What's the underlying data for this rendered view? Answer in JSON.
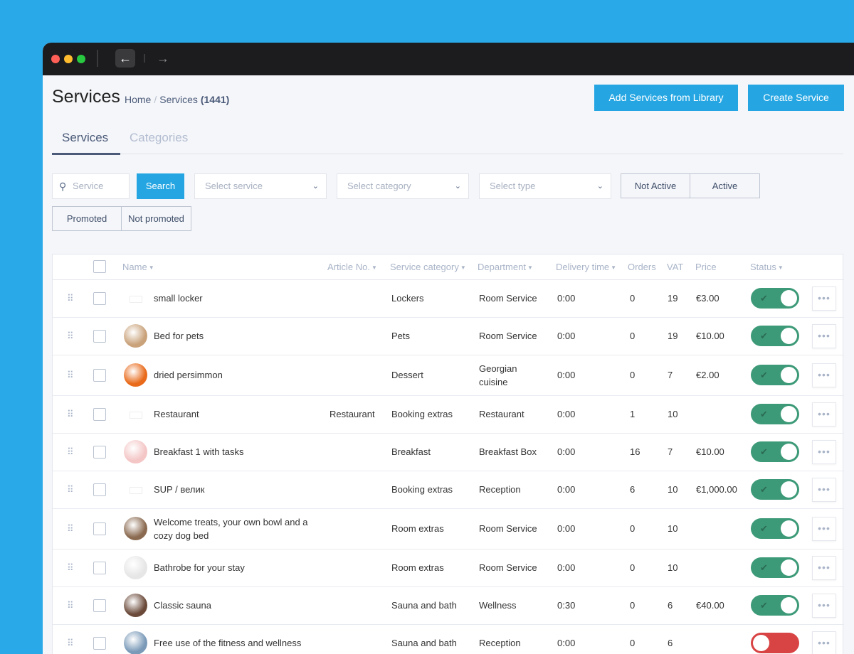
{
  "browser": {
    "back_icon": "←",
    "forward_icon": "→"
  },
  "header": {
    "title": "Services",
    "breadcrumb_home": "Home",
    "breadcrumb_sep": "/",
    "breadcrumb_current": "Services",
    "breadcrumb_count": "(1441)",
    "add_from_library": "Add Services from Library",
    "create_service": "Create Service"
  },
  "tabs": [
    {
      "label": "Services",
      "active": true
    },
    {
      "label": "Categories",
      "active": false
    }
  ],
  "filters": {
    "search_placeholder": "Service",
    "search_button": "Search",
    "select_service": "Select service",
    "select_category": "Select category",
    "select_type": "Select type",
    "not_active": "Not Active",
    "active": "Active",
    "promoted": "Promoted",
    "not_promoted": "Not promoted"
  },
  "columns": {
    "name": "Name",
    "article": "Article No.",
    "category": "Service category",
    "department": "Department",
    "delivery": "Delivery time",
    "orders": "Orders",
    "vat": "VAT",
    "price": "Price",
    "status": "Status"
  },
  "rows": [
    {
      "name": "small locker",
      "article": "",
      "category": "Lockers",
      "department": "Room Service",
      "delivery": "0:00",
      "orders": "0",
      "vat": "19",
      "price": "€3.00",
      "active": true,
      "avatar": "blank"
    },
    {
      "name": "Bed for pets",
      "article": "",
      "category": "Pets",
      "department": "Room Service",
      "delivery": "0:00",
      "orders": "0",
      "vat": "19",
      "price": "€10.00",
      "active": true,
      "avatar": "#c9a27a"
    },
    {
      "name": "dried persimmon",
      "article": "",
      "category": "Dessert",
      "department": "Georgian cuisine",
      "delivery": "0:00",
      "orders": "0",
      "vat": "7",
      "price": "€2.00",
      "active": true,
      "avatar": "#e86a1a"
    },
    {
      "name": "Restaurant",
      "article": "Restaurant",
      "category": "Booking extras",
      "department": "Restaurant",
      "delivery": "0:00",
      "orders": "1",
      "vat": "10",
      "price": "",
      "active": true,
      "avatar": "blank"
    },
    {
      "name": "Breakfast 1 with tasks",
      "article": "",
      "category": "Breakfast",
      "department": "Breakfast Box",
      "delivery": "0:00",
      "orders": "16",
      "vat": "7",
      "price": "€10.00",
      "active": true,
      "avatar": "#f4c6c6"
    },
    {
      "name": "SUP / велик",
      "article": "",
      "category": "Booking extras",
      "department": "Reception",
      "delivery": "0:00",
      "orders": "6",
      "vat": "10",
      "price": "€1,000.00",
      "active": true,
      "avatar": "blank"
    },
    {
      "name": "Welcome treats, your own bowl and a cozy dog bed",
      "article": "",
      "category": "Room extras",
      "department": "Room Service",
      "delivery": "0:00",
      "orders": "0",
      "vat": "10",
      "price": "",
      "active": true,
      "avatar": "#8a6a50"
    },
    {
      "name": "Bathrobe for your stay",
      "article": "",
      "category": "Room extras",
      "department": "Room Service",
      "delivery": "0:00",
      "orders": "0",
      "vat": "10",
      "price": "",
      "active": true,
      "avatar": "#e6e6e6"
    },
    {
      "name": "Classic sauna",
      "article": "",
      "category": "Sauna and bath",
      "department": "Wellness",
      "delivery": "0:30",
      "orders": "0",
      "vat": "6",
      "price": "€40.00",
      "active": true,
      "avatar": "#6b4a3a"
    },
    {
      "name": "Free use of the fitness and wellness",
      "article": "",
      "category": "Sauna and bath",
      "department": "Reception",
      "delivery": "0:00",
      "orders": "0",
      "vat": "6",
      "price": "",
      "active": false,
      "avatar": "#7a9ab8"
    }
  ]
}
